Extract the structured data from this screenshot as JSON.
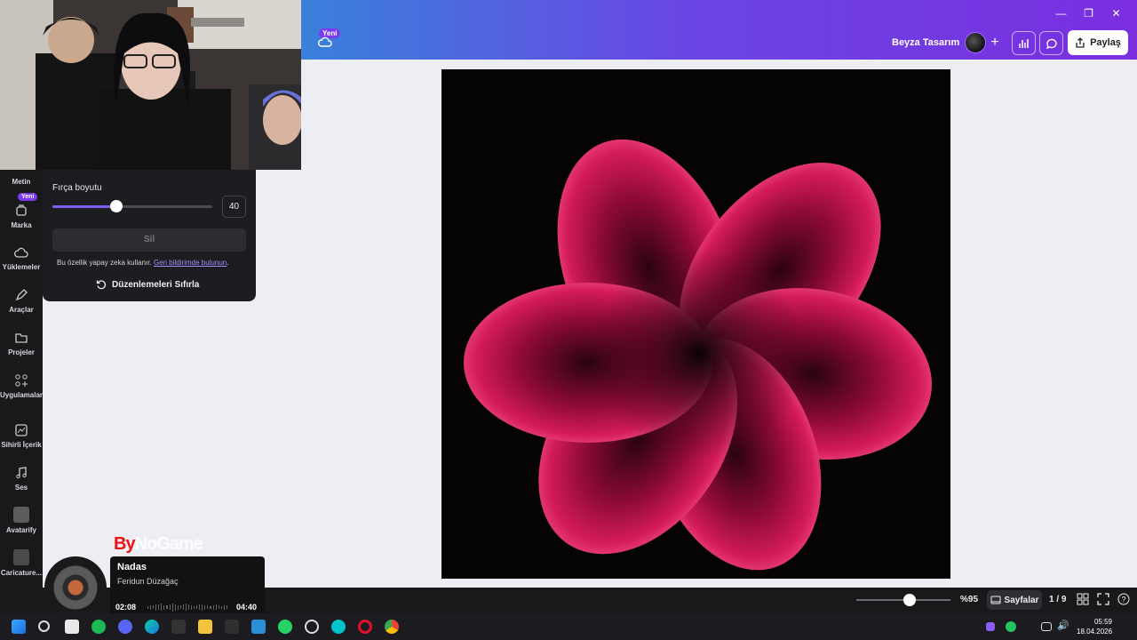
{
  "header": {
    "new_badge": "Yeni",
    "design_title": "Beyza Tasarım",
    "share_label": "Paylaş"
  },
  "rail": {
    "new_badge": "Yeni",
    "items": [
      {
        "label": "Metin",
        "icon": "text-icon"
      },
      {
        "label": "Marka",
        "icon": "brand-icon"
      },
      {
        "label": "Yüklemeler",
        "icon": "upload-cloud-icon"
      },
      {
        "label": "Araçlar",
        "icon": "pen-tool-icon"
      },
      {
        "label": "Projeler",
        "icon": "folder-icon"
      },
      {
        "label": "Uygulamalar",
        "icon": "apps-grid-icon"
      },
      {
        "label": "Sihirli İçerik",
        "icon": "magic-image-icon"
      },
      {
        "label": "Ses",
        "icon": "music-note-icon"
      },
      {
        "label": "Avatarify",
        "icon": "avatarify-app-icon"
      },
      {
        "label": "Caricature...",
        "icon": "caricature-app-icon"
      }
    ]
  },
  "panel": {
    "brush_label": "Fırça boyutu",
    "brush_size": "40",
    "brush_level": 0.4,
    "erase_label": "Sil",
    "note_text": "Bu özellik yapay zeka kullanır.",
    "feedback_link": "Geri bildirimde bulunun",
    "note_end": ".",
    "reset_label": "Düzenlemeleri Sıfırla"
  },
  "footer": {
    "zoom_label": "%95",
    "zoom_level": 0.57,
    "pages_label": "Sayfalar",
    "page_counter": "1 / 9"
  },
  "music": {
    "title": "Nadas",
    "artist": "Feridun Düzağaç",
    "elapsed": "02:08",
    "total": "04:40"
  },
  "overlay": {
    "brand_prefix": "By",
    "brand_name": "NoGame"
  },
  "taskbar": {
    "time": "05:59",
    "date": "18.04.2026"
  },
  "colors": {
    "accent": "#7d5cf0",
    "badge": "#7c3aed",
    "flower": "#c2104a"
  }
}
